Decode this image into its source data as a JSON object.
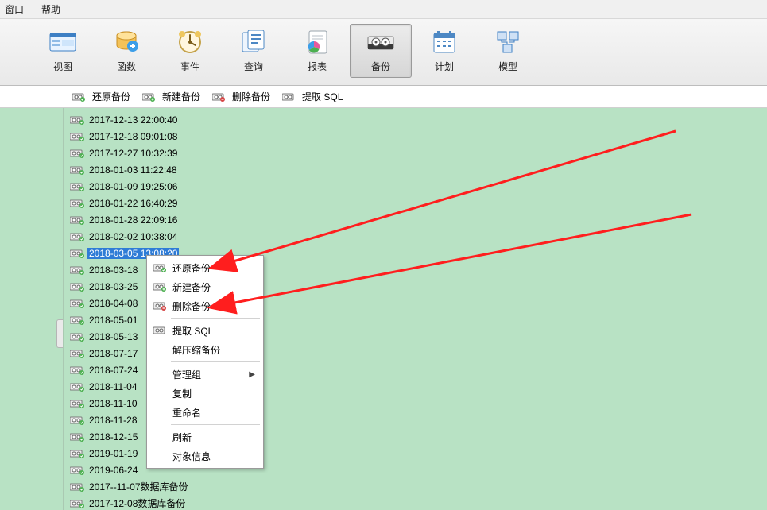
{
  "menu": {
    "window": "窗口",
    "help": "帮助"
  },
  "toolbar": {
    "view": "视图",
    "func": "函数",
    "event": "事件",
    "query": "查询",
    "report": "报表",
    "backup": "备份",
    "plan": "计划",
    "model": "模型"
  },
  "actions": {
    "restore": "还原备份",
    "new": "新建备份",
    "delete": "删除备份",
    "extract": "提取 SQL"
  },
  "files": [
    "2017-12-13 22:00:40",
    "2017-12-18 09:01:08",
    "2017-12-27 10:32:39",
    "2018-01-03 11:22:48",
    "2018-01-09 19:25:06",
    "2018-01-22 16:40:29",
    "2018-01-28 22:09:16",
    "2018-02-02 10:38:04",
    "2018-03-05 13:08:20",
    "2018-03-18",
    "2018-03-25",
    "2018-04-08",
    "2018-05-01",
    "2018-05-13",
    "2018-07-17",
    "2018-07-24",
    "2018-11-04",
    "2018-11-10",
    "2018-11-28",
    "2018-12-15",
    "2019-01-19",
    "2019-06-24",
    "2017--11-07数据库备份",
    "2017-12-08数据库备份"
  ],
  "selected_index": 8,
  "context_menu": {
    "restore": "还原备份",
    "new": "新建备份",
    "delete": "删除备份",
    "extract": "提取 SQL",
    "unzip": "解压缩备份",
    "group": "管理组",
    "copy": "复制",
    "rename": "重命名",
    "refresh": "刷新",
    "objinfo": "对象信息"
  }
}
